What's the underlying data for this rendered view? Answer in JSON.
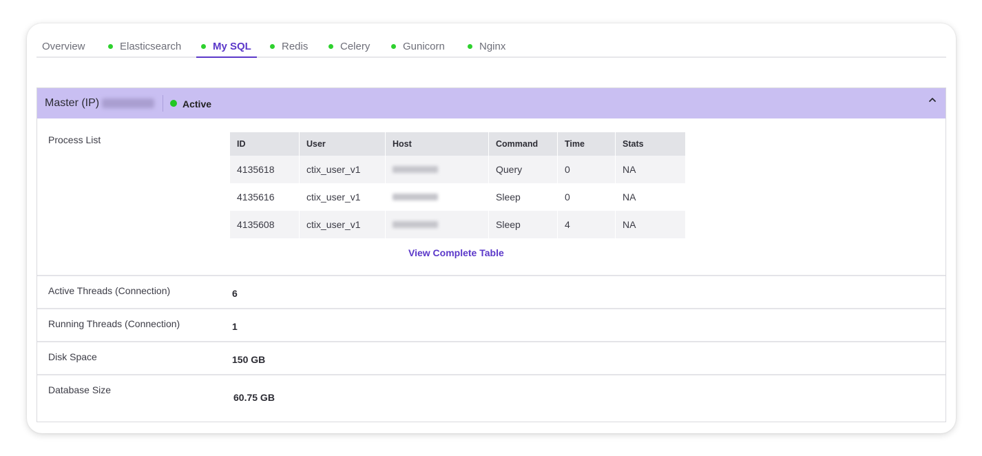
{
  "tabs": [
    {
      "label": "Overview",
      "has_status": false,
      "active": false
    },
    {
      "label": "Elasticsearch",
      "has_status": true,
      "active": false
    },
    {
      "label": "My SQL",
      "has_status": true,
      "active": true
    },
    {
      "label": "Redis",
      "has_status": true,
      "active": false
    },
    {
      "label": "Celery",
      "has_status": true,
      "active": false
    },
    {
      "label": "Gunicorn",
      "has_status": true,
      "active": false
    },
    {
      "label": "Nginx",
      "has_status": true,
      "active": false
    }
  ],
  "section": {
    "title": "Master (IP)",
    "status": "Active",
    "status_color": "#22c722",
    "header_color": "#c9bff2",
    "collapse_icon": "chevron-up-icon"
  },
  "process_list": {
    "label": "Process List",
    "columns": [
      "ID",
      "User",
      "Host",
      "Command",
      "Time",
      "Stats"
    ],
    "rows": [
      {
        "id": "4135618",
        "user": "ctix_user_v1",
        "command": "Query",
        "time": "0",
        "stats": "NA"
      },
      {
        "id": "4135616",
        "user": "ctix_user_v1",
        "command": "Sleep",
        "time": "0",
        "stats": "NA"
      },
      {
        "id": "4135608",
        "user": "ctix_user_v1",
        "command": "Sleep",
        "time": "4",
        "stats": "NA"
      }
    ],
    "view_link": "View Complete Table"
  },
  "metrics": [
    {
      "label": "Active Threads (Connection)",
      "value": "6"
    },
    {
      "label": "Running Threads (Connection)",
      "value": "1"
    },
    {
      "label": "Disk Space",
      "value": "150 GB"
    },
    {
      "label": "Database Size",
      "value": "60.75 GB"
    }
  ],
  "colors": {
    "accent": "#5b38c9",
    "status_green": "#2ed12e"
  }
}
